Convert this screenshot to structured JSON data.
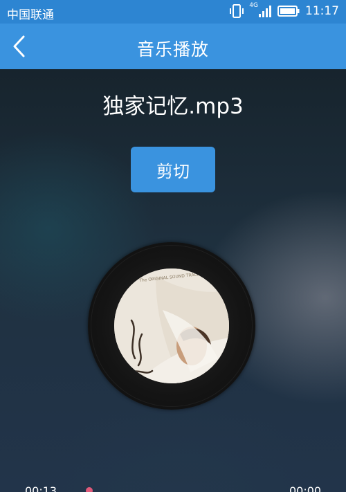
{
  "status_bar": {
    "carrier": "中国联通",
    "network": "4G",
    "time": "11:17"
  },
  "header": {
    "title": "音乐播放"
  },
  "song": {
    "filename": "独家记忆.mp3"
  },
  "actions": {
    "cut_label": "剪切"
  },
  "cover": {
    "top_text": "The ORIGINAL SOUND TRACK"
  },
  "player": {
    "current_time": "00:13",
    "total_time": "00:00"
  },
  "colors": {
    "status_bar": "#2d85d2",
    "header": "#3a93df",
    "accent": "#3a93df",
    "progress_dot": "#e05a7a"
  }
}
